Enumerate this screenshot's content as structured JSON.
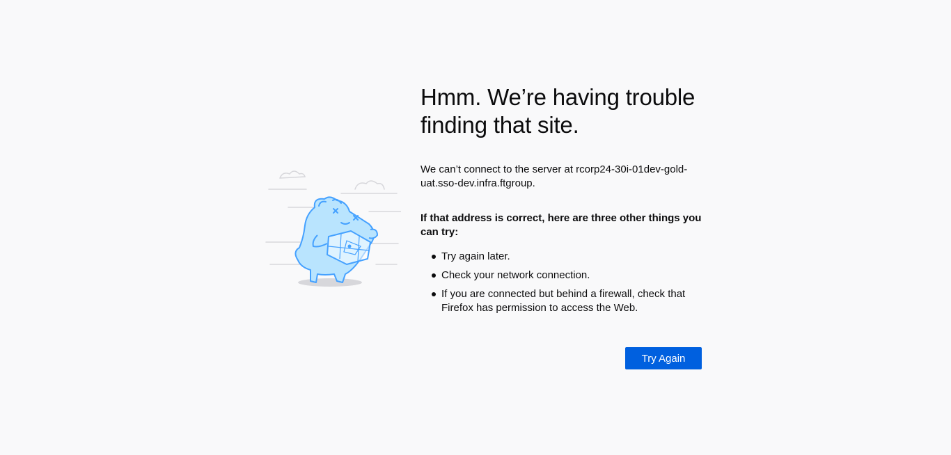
{
  "error_page": {
    "title": "Hmm. We’re having trouble finding that site.",
    "description": "We can’t connect to the server at rcorp24-30i-01dev-gold-uat.sso-dev.infra.ftgroup.",
    "suggestions_heading": "If that address is correct, here are three other things you can try:",
    "suggestions": [
      "Try again later.",
      "Check your network connection.",
      "If you are connected but behind a firewall, check that Firefox has permission to access the Web."
    ],
    "try_again_label": "Try Again"
  },
  "colors": {
    "background": "#f9f9fa",
    "button": "#0060df",
    "illustration_stroke": "#45a1ff",
    "illustration_fill": "#b9e4fe"
  },
  "icons": {
    "illustration": "confused-monster-with-map-icon"
  }
}
